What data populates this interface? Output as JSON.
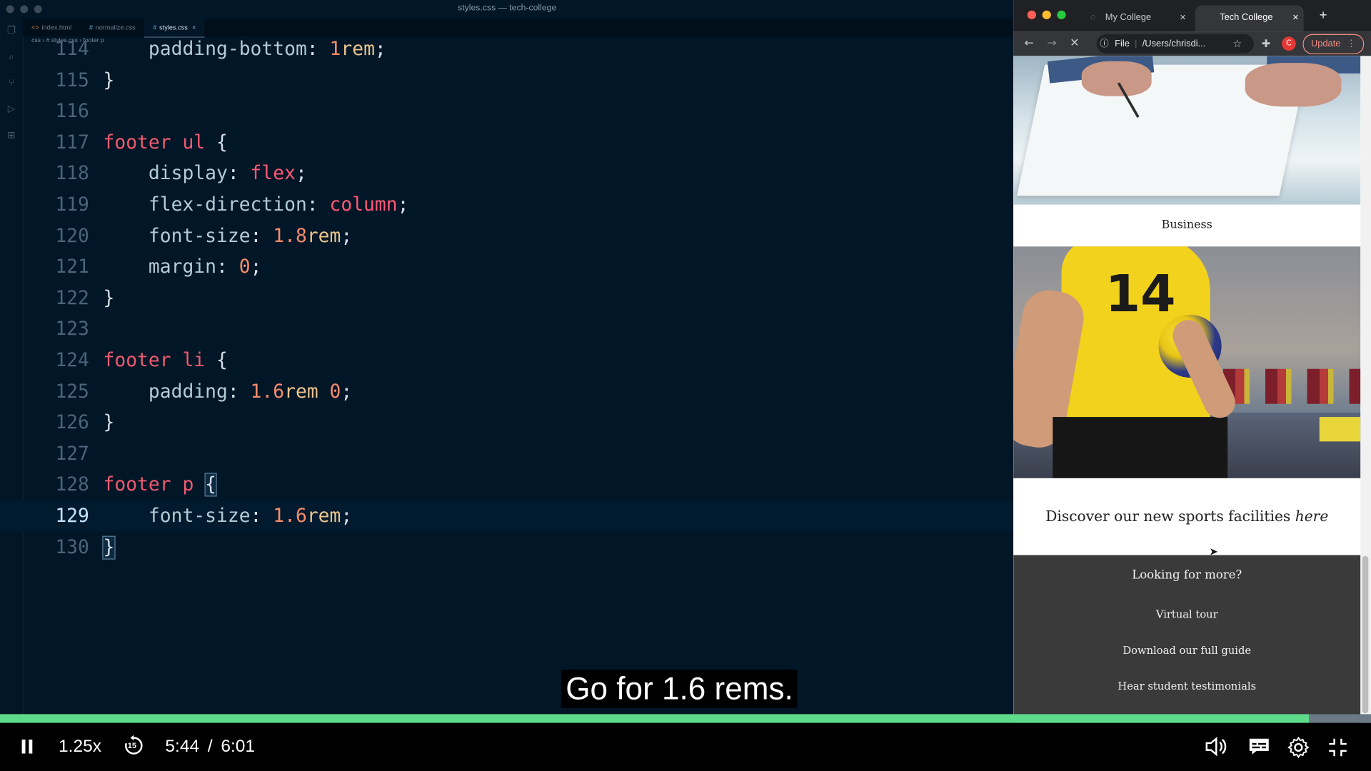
{
  "editor": {
    "window_title": "styles.css — tech-college",
    "tabs": [
      {
        "icon": "<>",
        "label": "index.html"
      },
      {
        "icon": "#",
        "label": "normalize.css"
      },
      {
        "icon": "#",
        "label": "styles.css",
        "active": true
      }
    ],
    "breadcrumb": [
      "css",
      "# styles.css",
      "footer p"
    ],
    "current_line": 129,
    "lines": [
      {
        "n": "114",
        "text": "    padding-bottom: 1rem;"
      },
      {
        "n": "115",
        "text": "}"
      },
      {
        "n": "116",
        "text": ""
      },
      {
        "n": "117",
        "text": "footer ul {"
      },
      {
        "n": "118",
        "text": "    display: flex;"
      },
      {
        "n": "119",
        "text": "    flex-direction: column;"
      },
      {
        "n": "120",
        "text": "    font-size: 1.8rem;"
      },
      {
        "n": "121",
        "text": "    margin: 0;"
      },
      {
        "n": "122",
        "text": "}"
      },
      {
        "n": "123",
        "text": ""
      },
      {
        "n": "124",
        "text": "footer li {"
      },
      {
        "n": "125",
        "text": "    padding: 1.6rem 0;"
      },
      {
        "n": "126",
        "text": "}"
      },
      {
        "n": "127",
        "text": ""
      },
      {
        "n": "128",
        "text": "footer p {"
      },
      {
        "n": "129",
        "text": "    font-size: 1.6rem;"
      },
      {
        "n": "130",
        "text": "}"
      }
    ]
  },
  "browser": {
    "tabs": [
      {
        "label": "My College",
        "close": "✕"
      },
      {
        "label": "Tech College",
        "close": "✕",
        "active": true
      }
    ],
    "new_tab": "+",
    "address_scheme": "File",
    "address": "/Users/chrisdi...",
    "update_label": "Update",
    "avatar_letter": "C",
    "page": {
      "caption_business": "Business",
      "jersey_number": "14",
      "sports_text": "Discover our new sports facilities",
      "sports_link": "here",
      "footer_heading": "Looking for more?",
      "footer_links": [
        "Virtual tour",
        "Download our full guide",
        "Hear student testimonials"
      ]
    }
  },
  "player": {
    "subtitle": "Go for 1.6 rems.",
    "speed": "1.25x",
    "skip_back": "15",
    "current_time": "5:44",
    "separator": "/",
    "duration": "6:01",
    "progress_fraction": 0.955,
    "progress_color": "#5ddb8a"
  },
  "colors": {
    "editor_bg": "#011627",
    "selector": "#ef5a6f",
    "property": "#b2ccd6",
    "number": "#f78c6c",
    "unit": "#ecc48d"
  }
}
